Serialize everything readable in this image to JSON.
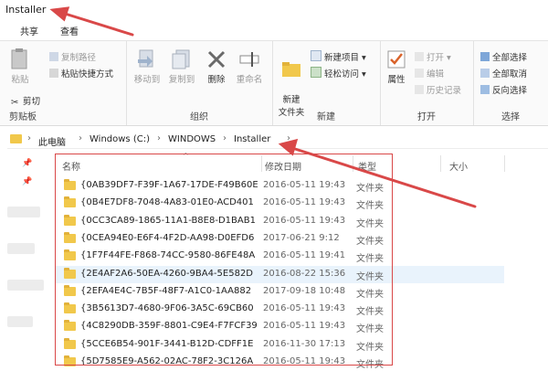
{
  "window": {
    "title": "Installer"
  },
  "tabs": [
    "共享",
    "查看"
  ],
  "ribbon": {
    "clipboard": {
      "paste": "粘贴",
      "cut": "剪切",
      "copy_path": "复制路径",
      "paste_shortcut": "粘贴快捷方式",
      "label": "剪贴板"
    },
    "organize": {
      "move_to": "移动到",
      "copy_to": "复制到",
      "delete": "删除",
      "rename": "重命名",
      "label": "组织"
    },
    "new": {
      "new_item": "新建项目",
      "easy_access": "轻松访问",
      "new_folder": "新建\n文件夹",
      "label": "新建"
    },
    "open": {
      "properties": "属性",
      "open": "打开",
      "edit": "编辑",
      "history": "历史记录",
      "label": "打开"
    },
    "select": {
      "select_all": "全部选择",
      "select_none": "全部取消",
      "invert": "反向选择",
      "label": "选择"
    }
  },
  "address": {
    "crumbs": [
      "此电脑",
      "Windows (C:)",
      "WINDOWS",
      "Installer"
    ]
  },
  "columns": {
    "name": "名称",
    "date": "修改日期",
    "type": "类型",
    "size": "大小"
  },
  "files": [
    {
      "name": "{0AB39DF7-F39F-1A67-17DE-F49B60E",
      "date": "2016-05-11 19:43",
      "type": "文件夹"
    },
    {
      "name": "{0B4E7DF8-7048-4A83-01E0-ACD401",
      "date": "2016-05-11 19:43",
      "type": "文件夹"
    },
    {
      "name": "{0CC3CA89-1865-11A1-B8E8-D1BAB1",
      "date": "2016-05-11 19:43",
      "type": "文件夹"
    },
    {
      "name": "{0CEA94E0-E6F4-4F2D-AA98-D0EFD6",
      "date": "2017-06-21 9:12",
      "type": "文件夹"
    },
    {
      "name": "{1F7F44FE-F868-74CC-9580-86FE48A",
      "date": "2016-05-11 19:41",
      "type": "文件夹"
    },
    {
      "name": "{2E4AF2A6-50EA-4260-9BA4-5E582D",
      "date": "2016-08-22 15:36",
      "type": "文件夹"
    },
    {
      "name": "{2EFA4E4C-7B5F-48F7-A1C0-1AA882",
      "date": "2017-09-18 10:48",
      "type": "文件夹"
    },
    {
      "name": "{3B5613D7-4680-9F06-3A5C-69CB60",
      "date": "2016-05-11 19:43",
      "type": "文件夹"
    },
    {
      "name": "{4C8290DB-359F-8801-C9E4-F7FCF39",
      "date": "2016-05-11 19:43",
      "type": "文件夹"
    },
    {
      "name": "{5CCE6B54-901F-3441-B12D-CDFF1E",
      "date": "2016-11-30 17:13",
      "type": "文件夹"
    },
    {
      "name": "{5D7585E9-A562-02AC-78F2-3C126A",
      "date": "2016-05-11 19:43",
      "type": "文件夹"
    }
  ],
  "selected_row": 5,
  "colors": {
    "annotation": "#d94848",
    "folder": "#f1c84b",
    "selection": "#e9f3fc"
  }
}
